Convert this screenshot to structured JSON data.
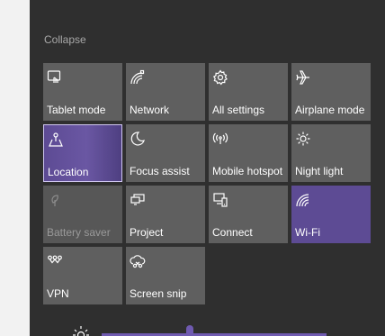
{
  "panel": {
    "collapse_label": "Collapse"
  },
  "tiles": [
    {
      "id": "tablet-mode",
      "label": "Tablet mode",
      "icon": "tablet-mode-icon",
      "state": "off"
    },
    {
      "id": "network",
      "label": "Network",
      "icon": "network-icon",
      "state": "off"
    },
    {
      "id": "all-settings",
      "label": "All settings",
      "icon": "gear-icon",
      "state": "off"
    },
    {
      "id": "airplane-mode",
      "label": "Airplane mode",
      "icon": "airplane-icon",
      "state": "off"
    },
    {
      "id": "location",
      "label": "Location",
      "icon": "location-icon",
      "state": "on-selected"
    },
    {
      "id": "focus-assist",
      "label": "Focus assist",
      "icon": "moon-icon",
      "state": "off"
    },
    {
      "id": "mobile-hotspot",
      "label": "Mobile hotspot",
      "icon": "hotspot-icon",
      "state": "off"
    },
    {
      "id": "night-light",
      "label": "Night light",
      "icon": "brightness-icon",
      "state": "off"
    },
    {
      "id": "battery-saver",
      "label": "Battery saver",
      "icon": "battery-saver-icon",
      "state": "disabled"
    },
    {
      "id": "project",
      "label": "Project",
      "icon": "project-icon",
      "state": "off"
    },
    {
      "id": "connect",
      "label": "Connect",
      "icon": "connect-icon",
      "state": "off"
    },
    {
      "id": "wifi",
      "label": "Wi-Fi",
      "icon": "wifi-icon",
      "state": "on"
    },
    {
      "id": "vpn",
      "label": "VPN",
      "icon": "vpn-icon",
      "state": "off"
    },
    {
      "id": "screen-snip",
      "label": "Screen snip",
      "icon": "screen-snip-icon",
      "state": "off"
    }
  ],
  "brightness": {
    "level_percent": 38,
    "icon": "brightness-icon"
  },
  "colors": {
    "panel_bg": "#2f2f2f",
    "tile_bg": "#5f5f5f",
    "accent": "#5d4b94",
    "text": "#ffffff",
    "muted_text": "#a8a8a8"
  }
}
